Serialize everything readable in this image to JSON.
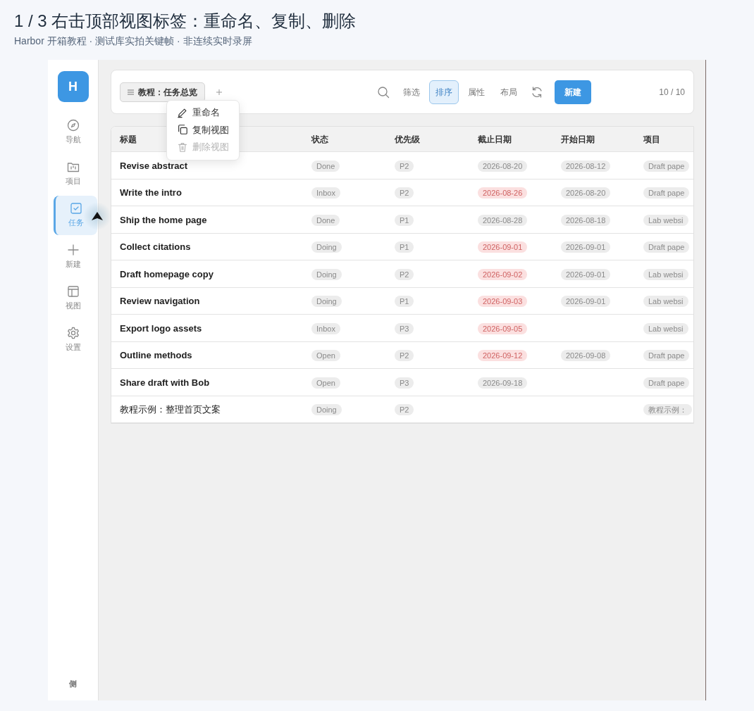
{
  "header": {
    "title": "1 / 3  右击顶部视图标签：重命名、复制、删除",
    "subtitle": "Harbor 开箱教程 · 测试库实拍关键帧 · 非连续实时录屏"
  },
  "sidebar": {
    "logo": "H",
    "items": [
      {
        "label": "导航",
        "selected": false
      },
      {
        "label": "项目",
        "selected": false
      },
      {
        "label": "任务",
        "selected": true
      },
      {
        "label": "新建",
        "selected": false
      },
      {
        "label": "视图",
        "selected": false
      },
      {
        "label": "设置",
        "selected": false
      }
    ],
    "footer": "侧"
  },
  "toolbar": {
    "view_tab": "教程：任务总览",
    "actions": [
      {
        "kind": "icon"
      },
      {
        "kind": "text",
        "label": "筛选",
        "selected": false
      },
      {
        "kind": "text",
        "label": "排序",
        "selected": true
      },
      {
        "kind": "text",
        "label": "属性",
        "selected": false
      },
      {
        "kind": "text",
        "label": "布局",
        "selected": false
      },
      {
        "kind": "icon"
      },
      {
        "kind": "primary",
        "label": "新建"
      }
    ],
    "count": "10 / 10"
  },
  "context_menu": [
    {
      "label": "重命名",
      "disabled": false
    },
    {
      "label": "复制视图",
      "disabled": false
    },
    {
      "label": "删除视图",
      "disabled": true
    }
  ],
  "table": {
    "columns": [
      "标题",
      "状态",
      "优先级",
      "截止日期",
      "开始日期",
      "项目"
    ],
    "rows": [
      {
        "title": "Revise abstract",
        "emphasized": true,
        "status": "Done",
        "priority": "P2",
        "due": "2026-08-20",
        "overdue": false,
        "start": "2026-08-12",
        "project": "Draft pape"
      },
      {
        "title": "Write the intro",
        "emphasized": true,
        "status": "Inbox",
        "priority": "P2",
        "due": "2026-08-26",
        "overdue": true,
        "start": "2026-08-20",
        "project": "Draft pape"
      },
      {
        "title": "Ship the home page",
        "emphasized": true,
        "status": "Done",
        "priority": "P1",
        "due": "2026-08-28",
        "overdue": false,
        "start": "2026-08-18",
        "project": "Lab websi"
      },
      {
        "title": "Collect citations",
        "emphasized": true,
        "status": "Doing",
        "priority": "P1",
        "due": "2026-09-01",
        "overdue": true,
        "start": "2026-09-01",
        "project": "Draft pape"
      },
      {
        "title": "Draft homepage copy",
        "emphasized": true,
        "status": "Doing",
        "priority": "P2",
        "due": "2026-09-02",
        "overdue": true,
        "start": "2026-09-01",
        "project": "Lab websi"
      },
      {
        "title": "Review navigation",
        "emphasized": true,
        "status": "Doing",
        "priority": "P1",
        "due": "2026-09-03",
        "overdue": true,
        "start": "2026-09-01",
        "project": "Lab websi"
      },
      {
        "title": "Export logo assets",
        "emphasized": true,
        "status": "Inbox",
        "priority": "P3",
        "due": "2026-09-05",
        "overdue": true,
        "project": "Lab websi"
      },
      {
        "title": "Outline methods",
        "emphasized": true,
        "status": "Open",
        "priority": "P2",
        "due": "2026-09-12",
        "overdue": true,
        "start": "2026-09-08",
        "project": "Draft pape"
      },
      {
        "title": "Share draft with Bob",
        "emphasized": true,
        "status": "Open",
        "priority": "P3",
        "due": "2026-09-18",
        "overdue": false,
        "project": "Draft pape"
      },
      {
        "title": "教程示例：整理首页文案",
        "emphasized": false,
        "status": "Doing",
        "priority": "P2",
        "project": "教程示例："
      }
    ]
  }
}
